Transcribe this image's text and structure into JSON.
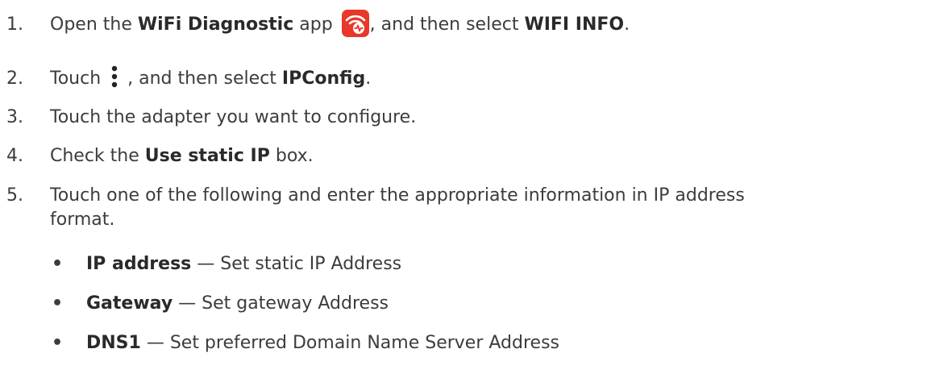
{
  "steps": [
    {
      "num": "1.",
      "pre": "Open the ",
      "bold1": "WiFi Diagnostic",
      "mid": " app ",
      "icon": "wifi-diagnostic-app-icon",
      "post": ", and then select ",
      "bold2": "WIFI INFO",
      "end": "."
    },
    {
      "num": "2.",
      "pre": "Touch ",
      "icon": "more-options-icon",
      "post": ", and then select ",
      "bold": "IPConfig",
      "end": "."
    },
    {
      "num": "3.",
      "text": "Touch the adapter you want to configure."
    },
    {
      "num": "4.",
      "pre": "Check the ",
      "bold": "Use static IP",
      "post": " box."
    },
    {
      "num": "5.",
      "line1": "Touch one of the following and enter the appropriate information in IP address",
      "line2": "format."
    }
  ],
  "bullets": [
    {
      "mark": "•",
      "term": "IP address",
      "desc": " — Set static IP Address"
    },
    {
      "mark": "•",
      "term": "Gateway",
      "desc": " — Set gateway Address"
    },
    {
      "mark": "•",
      "term": "DNS1",
      "desc": " — Set preferred Domain Name Server Address"
    }
  ],
  "colors": {
    "text": "#3c3c3c",
    "app_icon_bg": "#e8382a"
  }
}
